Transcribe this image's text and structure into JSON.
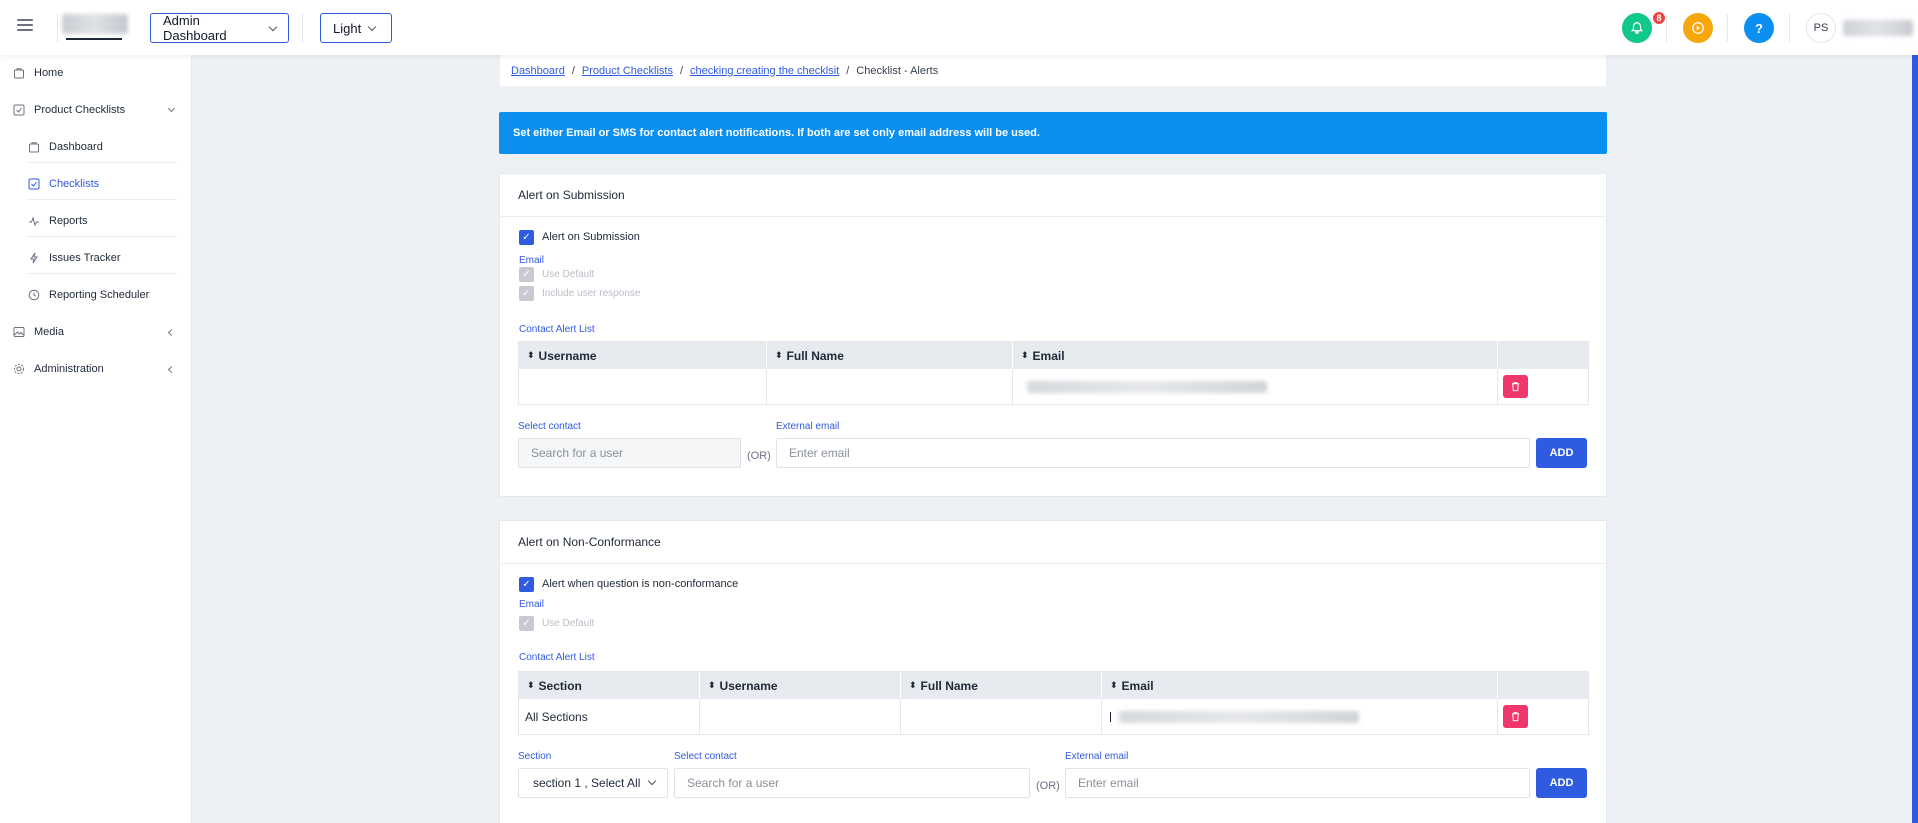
{
  "header": {
    "dashboard_select": "Admin Dashboard",
    "theme_select": "Light",
    "notification_count": "8",
    "help_label": "?",
    "avatar_initials": "PS"
  },
  "sidebar": {
    "items": [
      {
        "label": "Home",
        "icon": "home-icon"
      },
      {
        "label": "Product Checklists",
        "icon": "checklist-icon"
      },
      {
        "label": "Dashboard",
        "icon": "dashboard-icon"
      },
      {
        "label": "Checklists",
        "icon": "checklists-icon"
      },
      {
        "label": "Reports",
        "icon": "reports-icon"
      },
      {
        "label": "Issues Tracker",
        "icon": "issues-icon"
      },
      {
        "label": "Reporting Scheduler",
        "icon": "clock-icon"
      },
      {
        "label": "Media",
        "icon": "image-icon"
      },
      {
        "label": "Administration",
        "icon": "gear-icon"
      }
    ]
  },
  "breadcrumb": {
    "items": [
      "Dashboard",
      "Product Checklists",
      "checking creating the checklsit"
    ],
    "current": "Checklist - Alerts"
  },
  "info_banner": "Set either Email or SMS for contact alert notifications. If both are set only email address will be used.",
  "submission": {
    "title": "Alert on Submission",
    "checkbox_label": "Alert on Submission",
    "email_label": "Email",
    "use_default": "Use Default",
    "include_response": "Include user response",
    "list_title": "Contact Alert List",
    "columns": [
      "Username",
      "Full Name",
      "Email"
    ],
    "rows": [
      {
        "username": "",
        "full_name": ""
      }
    ],
    "select_contact_label": "Select contact",
    "search_placeholder": "Search for a user",
    "or_label": "(OR)",
    "external_email_label": "External email",
    "email_placeholder": "Enter email",
    "add_label": "ADD"
  },
  "nonconformance": {
    "title": "Alert on Non-Conformance",
    "checkbox_label": "Alert when question is non-conformance",
    "email_label": "Email",
    "use_default": "Use Default",
    "list_title": "Contact Alert List",
    "columns": [
      "Section",
      "Username",
      "Full Name",
      "Email"
    ],
    "rows": [
      {
        "section": "All Sections",
        "username": "",
        "full_name": ""
      }
    ],
    "section_label": "Section",
    "section_value": "section 1 , Select All",
    "select_contact_label": "Select contact",
    "search_placeholder": "Search for a user",
    "or_label": "(OR)",
    "external_email_label": "External email",
    "email_placeholder": "Enter email",
    "add_label": "ADD"
  },
  "colors": {
    "primary": "#2f5be0",
    "banner": "#0b8ff0",
    "notification": "#10c88a",
    "activity": "#f5a70b",
    "help": "#0b8ff0",
    "danger": "#f0376b"
  }
}
